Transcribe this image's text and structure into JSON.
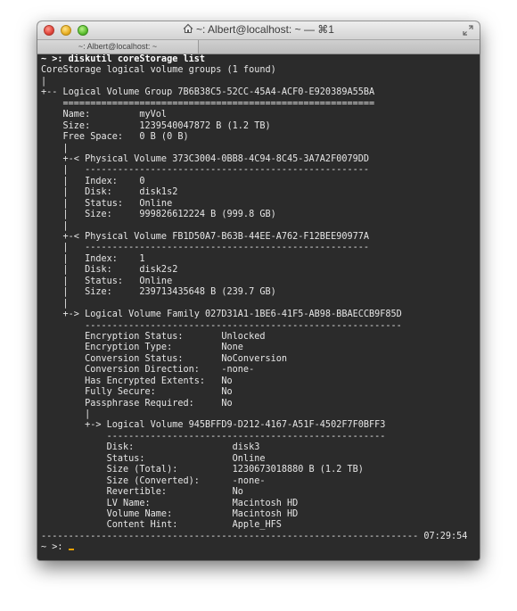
{
  "window": {
    "title": "~: Albert@localhost: ~ — ⌘1",
    "tab_label": "~: Albert@localhost: ~"
  },
  "terminal": {
    "lines": [
      {
        "text": "~ >: diskutil coreStorage list",
        "style": "bold"
      },
      {
        "text": "CoreStorage logical volume groups (1 found)"
      },
      {
        "text": "|"
      },
      {
        "text": "+-- Logical Volume Group 7B6B38C5-52CC-45A4-ACF0-E920389A55BA"
      },
      {
        "text": "    ========================================================="
      },
      {
        "text": "    Name:         myVol"
      },
      {
        "text": "    Size:         1239540047872 B (1.2 TB)"
      },
      {
        "text": "    Free Space:   0 B (0 B)"
      },
      {
        "text": "    |"
      },
      {
        "text": "    +-< Physical Volume 373C3004-0BB8-4C94-8C45-3A7A2F0079DD"
      },
      {
        "text": "    |   ----------------------------------------------------"
      },
      {
        "text": "    |   Index:    0"
      },
      {
        "text": "    |   Disk:     disk1s2"
      },
      {
        "text": "    |   Status:   Online"
      },
      {
        "text": "    |   Size:     999826612224 B (999.8 GB)"
      },
      {
        "text": "    |"
      },
      {
        "text": "    +-< Physical Volume FB1D50A7-B63B-44EE-A762-F12BEE90977A"
      },
      {
        "text": "    |   ----------------------------------------------------"
      },
      {
        "text": "    |   Index:    1"
      },
      {
        "text": "    |   Disk:     disk2s2"
      },
      {
        "text": "    |   Status:   Online"
      },
      {
        "text": "    |   Size:     239713435648 B (239.7 GB)"
      },
      {
        "text": "    |"
      },
      {
        "text": "    +-> Logical Volume Family 027D31A1-1BE6-41F5-AB98-BBAECCB9F85D"
      },
      {
        "text": "        ----------------------------------------------------------"
      },
      {
        "text": "        Encryption Status:       Unlocked"
      },
      {
        "text": "        Encryption Type:         None"
      },
      {
        "text": "        Conversion Status:       NoConversion"
      },
      {
        "text": "        Conversion Direction:    -none-"
      },
      {
        "text": "        Has Encrypted Extents:   No"
      },
      {
        "text": "        Fully Secure:            No"
      },
      {
        "text": "        Passphrase Required:     No"
      },
      {
        "text": "        |"
      },
      {
        "text": "        +-> Logical Volume 945BFFD9-D212-4167-A51F-4502F7F0BFF3"
      },
      {
        "text": "            ---------------------------------------------------"
      },
      {
        "text": "            Disk:                  disk3"
      },
      {
        "text": "            Status:                Online"
      },
      {
        "text": "            Size (Total):          1230673018880 B (1.2 TB)"
      },
      {
        "text": "            Size (Converted):      -none-"
      },
      {
        "text": "            Revertible:            No"
      },
      {
        "text": "            LV Name:               Macintosh HD"
      },
      {
        "text": "            Volume Name:           Macintosh HD"
      },
      {
        "text": "            Content Hint:          Apple_HFS"
      },
      {
        "text": "--------------------------------------------------------------------- 07:29:54"
      },
      {
        "text": "~ >: "
      }
    ]
  }
}
